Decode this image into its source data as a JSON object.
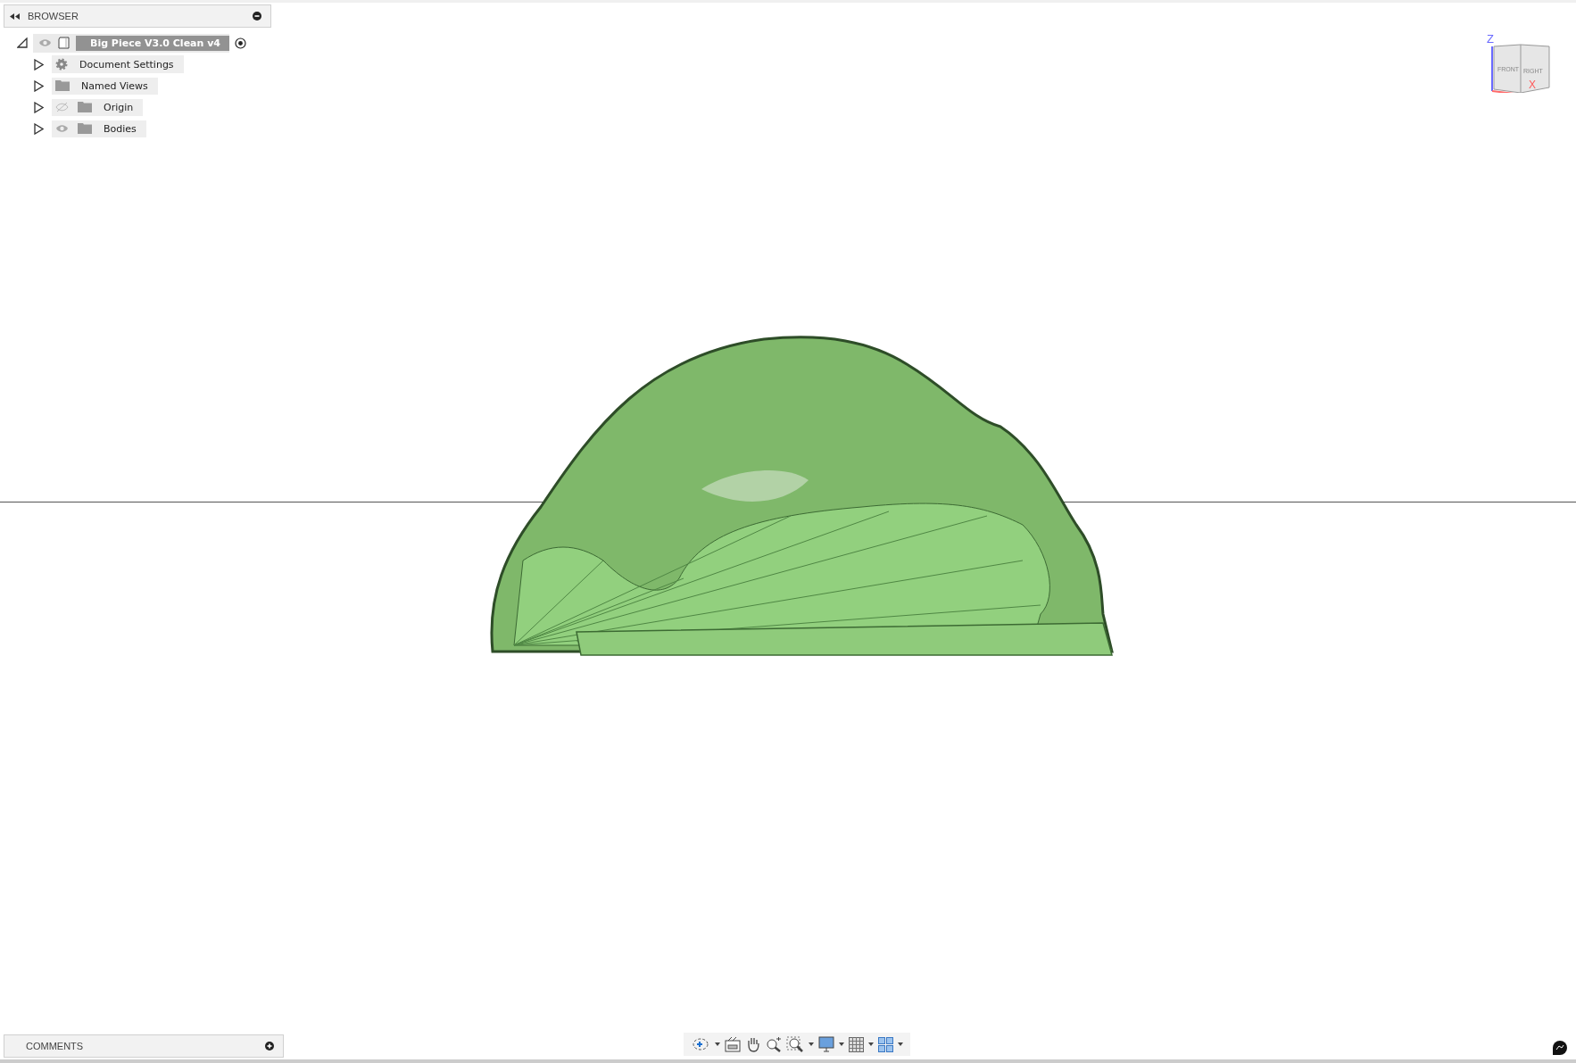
{
  "browser": {
    "title": "BROWSER",
    "root": {
      "label": "Big Piece V3.0 Clean v4",
      "expanded": true,
      "visible": true,
      "active": true,
      "children": [
        {
          "label": "Document Settings",
          "kind": "settings",
          "expanded": false
        },
        {
          "label": "Named Views",
          "kind": "folder",
          "expanded": false
        },
        {
          "label": "Origin",
          "kind": "folder",
          "expanded": false,
          "visible": false
        },
        {
          "label": "Bodies",
          "kind": "folder",
          "expanded": false,
          "visible": true
        }
      ]
    }
  },
  "viewcube": {
    "front": "FRONT",
    "right": "RIGHT",
    "z_axis": "Z",
    "x_axis": "X"
  },
  "comments": {
    "title": "COMMENTS"
  }
}
